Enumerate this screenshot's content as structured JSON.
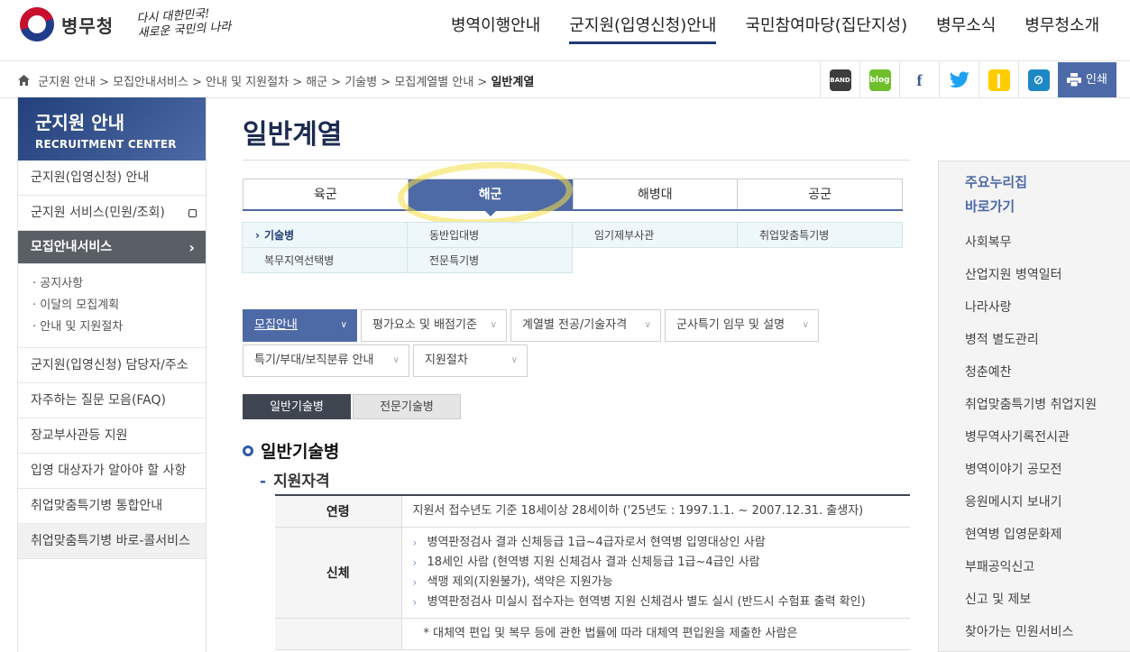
{
  "header": {
    "logo_text": "병무청",
    "slogan_line1": "다시 대한민국!",
    "slogan_line2": "새로운 국민의 나라",
    "menu": [
      "병역이행안내",
      "군지원(입영신청)안내",
      "국민참여마당(집단지성)",
      "병무소식",
      "병무청소개"
    ]
  },
  "breadcrumb": {
    "items": [
      "군지원 안내",
      "모집안내서비스",
      "안내 및 지원절차",
      "해군",
      "기술병",
      "모집계열별 안내"
    ],
    "current": "일반계열",
    "separator": ">"
  },
  "share": {
    "icons": [
      "band-icon",
      "blog-icon",
      "facebook-icon",
      "twitter-icon",
      "kakaostory-icon",
      "link-icon"
    ],
    "band_label": "BAND",
    "blog_label": "blog",
    "print_label": "인쇄"
  },
  "sidebar": {
    "title": "군지원 안내",
    "subtitle": "RECRUITMENT CENTER",
    "items": [
      {
        "label": "군지원(입영신청) 안내"
      },
      {
        "label": "군지원 서비스(민원/조회)"
      },
      {
        "label": "모집안내서비스"
      },
      {
        "label": "군지원(입영신청) 담당자/주소"
      },
      {
        "label": "자주하는 질문 모음(FAQ)"
      },
      {
        "label": "장교부사관등 지원"
      },
      {
        "label": "입영 대상자가 알아야 할 사항"
      },
      {
        "label": "취업맞춤특기병 통합안내"
      },
      {
        "label": "취업맞춤특기병 바로-콜서비스"
      }
    ],
    "sub_items": [
      "공지사항",
      "이달의 모집계획",
      "안내 및 지원절차"
    ]
  },
  "main": {
    "title": "일반계열",
    "branch_tabs": [
      "육군",
      "해군",
      "해병대",
      "공군"
    ],
    "sub_categories": [
      "기술병",
      "동반입대병",
      "임기제부사관",
      "취업맞춤특기병",
      "복무지역선택병",
      "전문특기병"
    ],
    "select_row1": [
      "모집안내",
      "평가요소 및 배점기준",
      "계열별 전공/기술자격",
      "군사특기 임무 및 설명"
    ],
    "select_row2": [
      "특기/부대/보직분류 안내",
      "지원절차"
    ],
    "tech_tabs": [
      "일반기술병",
      "전문기술병"
    ],
    "section_title": "일반기술병",
    "subsection_title": "지원자격",
    "table": {
      "rows": [
        {
          "header": "연령",
          "items": [
            "지원서 접수년도 기준 18세이상 28세이하 ('25년도 : 1997.1.1. ~ 2007.12.31. 출생자)"
          ]
        },
        {
          "header": "신체",
          "items": [
            "병역판정검사 결과 신체등급 1급~4급자로서 현역병 입영대상인 사람",
            "18세인 사람 (현역병 지원 신체검사 결과 신체등급 1급~4급인 사람",
            "색맹 제외(지원불가), 색약은 지원가능",
            "병역판정검사 미실시 접수자는 현역병 지원 신체검사 별도 실시 (반드시 수험표 출력 확인)"
          ]
        },
        {
          "header": "",
          "items": [
            "* 대체역 편입 및 복무 등에 관한 법률에 따라 대체역 편입원을 제출한 사람은"
          ]
        }
      ]
    }
  },
  "quick_links": {
    "title_line1": "주요누리집",
    "title_line2": "바로가기",
    "items": [
      "사회복무",
      "산업지원 병역일터",
      "나라사랑",
      "병적 별도관리",
      "청춘예찬",
      "취업맞춤특기병 취업지원",
      "병무역사기록전시관",
      "병역이야기 공모전",
      "응원메시지 보내기",
      "현역병 입영문화제",
      "부패공익신고",
      "신고 및 제보",
      "찾아가는 민원서비스"
    ]
  },
  "colors": {
    "primary": "#4e6aa6",
    "navy": "#1d2b4f",
    "active_nav": "#5a5f66",
    "highlight": "#f5de46"
  }
}
